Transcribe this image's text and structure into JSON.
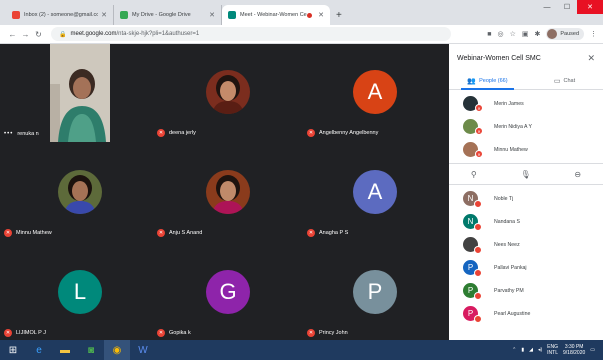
{
  "browser": {
    "tabs": [
      {
        "title": "Inbox (2) - someone@gmail.com",
        "favicon_color": "#ea4335"
      },
      {
        "title": "My Drive - Google Drive",
        "favicon_color": "#34a853"
      },
      {
        "title": "Meet - Webinar-Women Cell",
        "favicon_color": "#00897b",
        "active": true
      }
    ],
    "url_host": "meet.google.com",
    "url_path": "/nta-skje-hjk?pli=1&authuser=1",
    "profile_status": "Paused"
  },
  "tiles": [
    {
      "name": "renuka n",
      "kind": "video"
    },
    {
      "name": "deena jerly",
      "kind": "photo",
      "photo_bg": "#7b2d1e",
      "face": "#c48b6a"
    },
    {
      "name": "Angelbenny Angelbenny",
      "kind": "letter",
      "letter": "A",
      "color": "#d84315"
    },
    {
      "name": "Minnu Mathew",
      "kind": "photo",
      "photo_bg": "#5d6a3a",
      "face": "#a57256"
    },
    {
      "name": "Anju S Anand",
      "kind": "photo",
      "photo_bg": "#8a3b1c",
      "face": "#c08a6a"
    },
    {
      "name": "Anagha P S",
      "kind": "letter",
      "letter": "A",
      "color": "#5c6bc0"
    },
    {
      "name": "LIJIMOL P J",
      "kind": "letter",
      "letter": "L",
      "color": "#00897b"
    },
    {
      "name": "Gopika k",
      "kind": "letter",
      "letter": "G",
      "color": "#8e24aa"
    },
    {
      "name": "Princy John",
      "kind": "letter",
      "letter": "P",
      "color": "#78909c"
    }
  ],
  "panel": {
    "title": "Webinar-Women Cell SMC",
    "tab_people": "People (66)",
    "tab_chat": "Chat",
    "people_top": [
      {
        "name": "Merin James",
        "av": "#263238",
        "letter": ""
      },
      {
        "name": "Merin Nidiya A Y",
        "av": "#6d8b4a",
        "letter": ""
      },
      {
        "name": "Minnu Mathew",
        "av": "#a57256",
        "letter": ""
      }
    ],
    "people_bottom": [
      {
        "name": "Noble Tj",
        "av": "#8d6e63",
        "letter": "N"
      },
      {
        "name": "Nandana S",
        "av": "#00796b",
        "letter": "N"
      },
      {
        "name": "Nees Neez",
        "av": "#424242",
        "letter": ""
      },
      {
        "name": "Pallavi Pankaj",
        "av": "#1565c0",
        "letter": "P"
      },
      {
        "name": "Parvathy PM",
        "av": "#2e7d32",
        "letter": "P"
      },
      {
        "name": "Pearl Augustine",
        "av": "#d81b60",
        "letter": "P"
      }
    ]
  },
  "taskbar": {
    "lang": "ENG",
    "region": "INTL",
    "time": "3:30 PM",
    "date": "9/18/2020"
  }
}
